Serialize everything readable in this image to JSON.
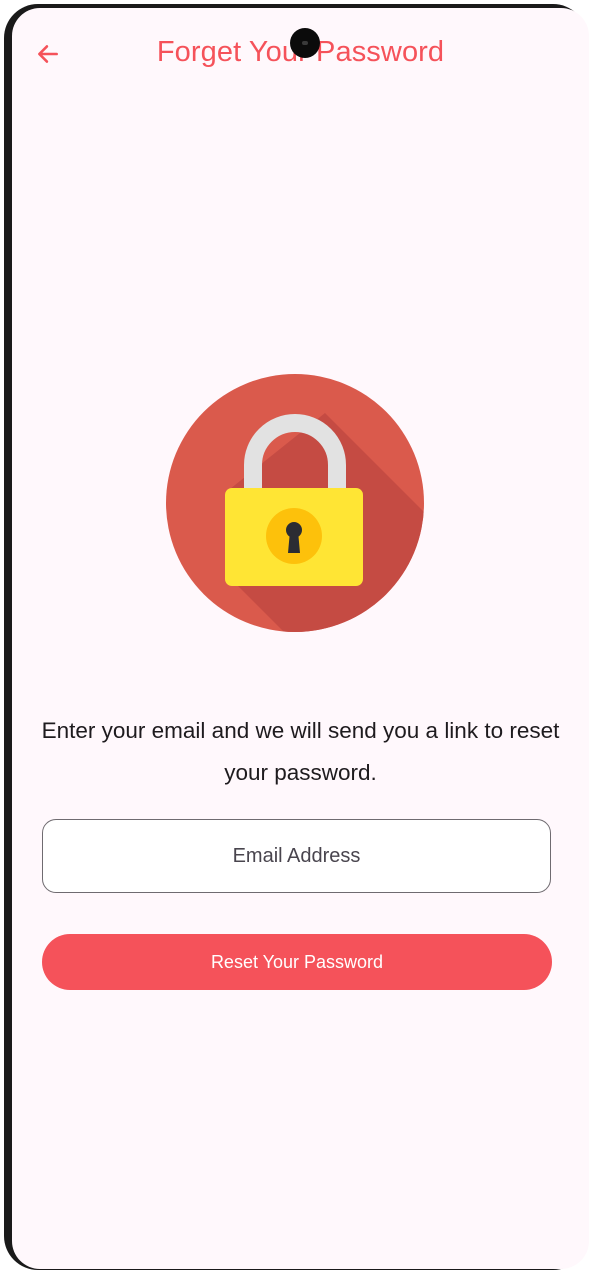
{
  "app_bar": {
    "title": "Forget Your Password",
    "back_icon": "arrow-left-icon"
  },
  "illustration": {
    "icon": "padlock-icon"
  },
  "message": {
    "text": "Enter your email and we will send you a link to reset your password."
  },
  "email_field": {
    "placeholder": "Email Address",
    "value": ""
  },
  "reset_button": {
    "label": "Reset Your Password"
  },
  "colors": {
    "accent": "#F5525A",
    "background": "#FFF8FC",
    "lock_circle": "#DA5A4C",
    "lock_body": "#FFE534",
    "lock_shackle": "#E2E2E2",
    "keyhole_ring": "#FDC10B"
  }
}
